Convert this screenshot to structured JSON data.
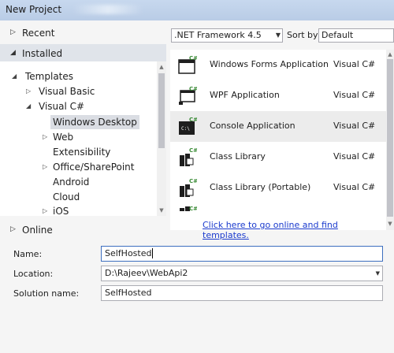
{
  "window": {
    "title": "New Project"
  },
  "nav": {
    "recent": "Recent",
    "installed": "Installed",
    "online": "Online"
  },
  "tree": {
    "templates": "Templates",
    "visual_basic": "Visual Basic",
    "visual_csharp": "Visual C#",
    "windows_desktop": "Windows Desktop",
    "web": "Web",
    "extensibility": "Extensibility",
    "office_sharepoint": "Office/SharePoint",
    "android": "Android",
    "cloud": "Cloud",
    "ios": "iOS"
  },
  "toolbar": {
    "framework": ".NET Framework 4.5",
    "sort_by_label": "Sort by:",
    "sort_value": "Default"
  },
  "templates": [
    {
      "name": "Windows Forms Application",
      "lang": "Visual C#",
      "icon": "winforms-icon"
    },
    {
      "name": "WPF Application",
      "lang": "Visual C#",
      "icon": "wpf-icon"
    },
    {
      "name": "Console Application",
      "lang": "Visual C#",
      "icon": "console-icon"
    },
    {
      "name": "Class Library",
      "lang": "Visual C#",
      "icon": "class-library-icon"
    },
    {
      "name": "Class Library (Portable)",
      "lang": "Visual C#",
      "icon": "portable-library-icon"
    }
  ],
  "online_link": "Click here to go online and find templates.",
  "form": {
    "name_label": "Name:",
    "name_value": "SelfHosted",
    "location_label": "Location:",
    "location_value": "D:\\Rajeev\\WebApi2",
    "solution_label": "Solution name:",
    "solution_value": "SelfHosted"
  },
  "colors": {
    "link": "#1a3acd",
    "selection": "#dadde3",
    "focus_border": "#3d6fbf"
  }
}
